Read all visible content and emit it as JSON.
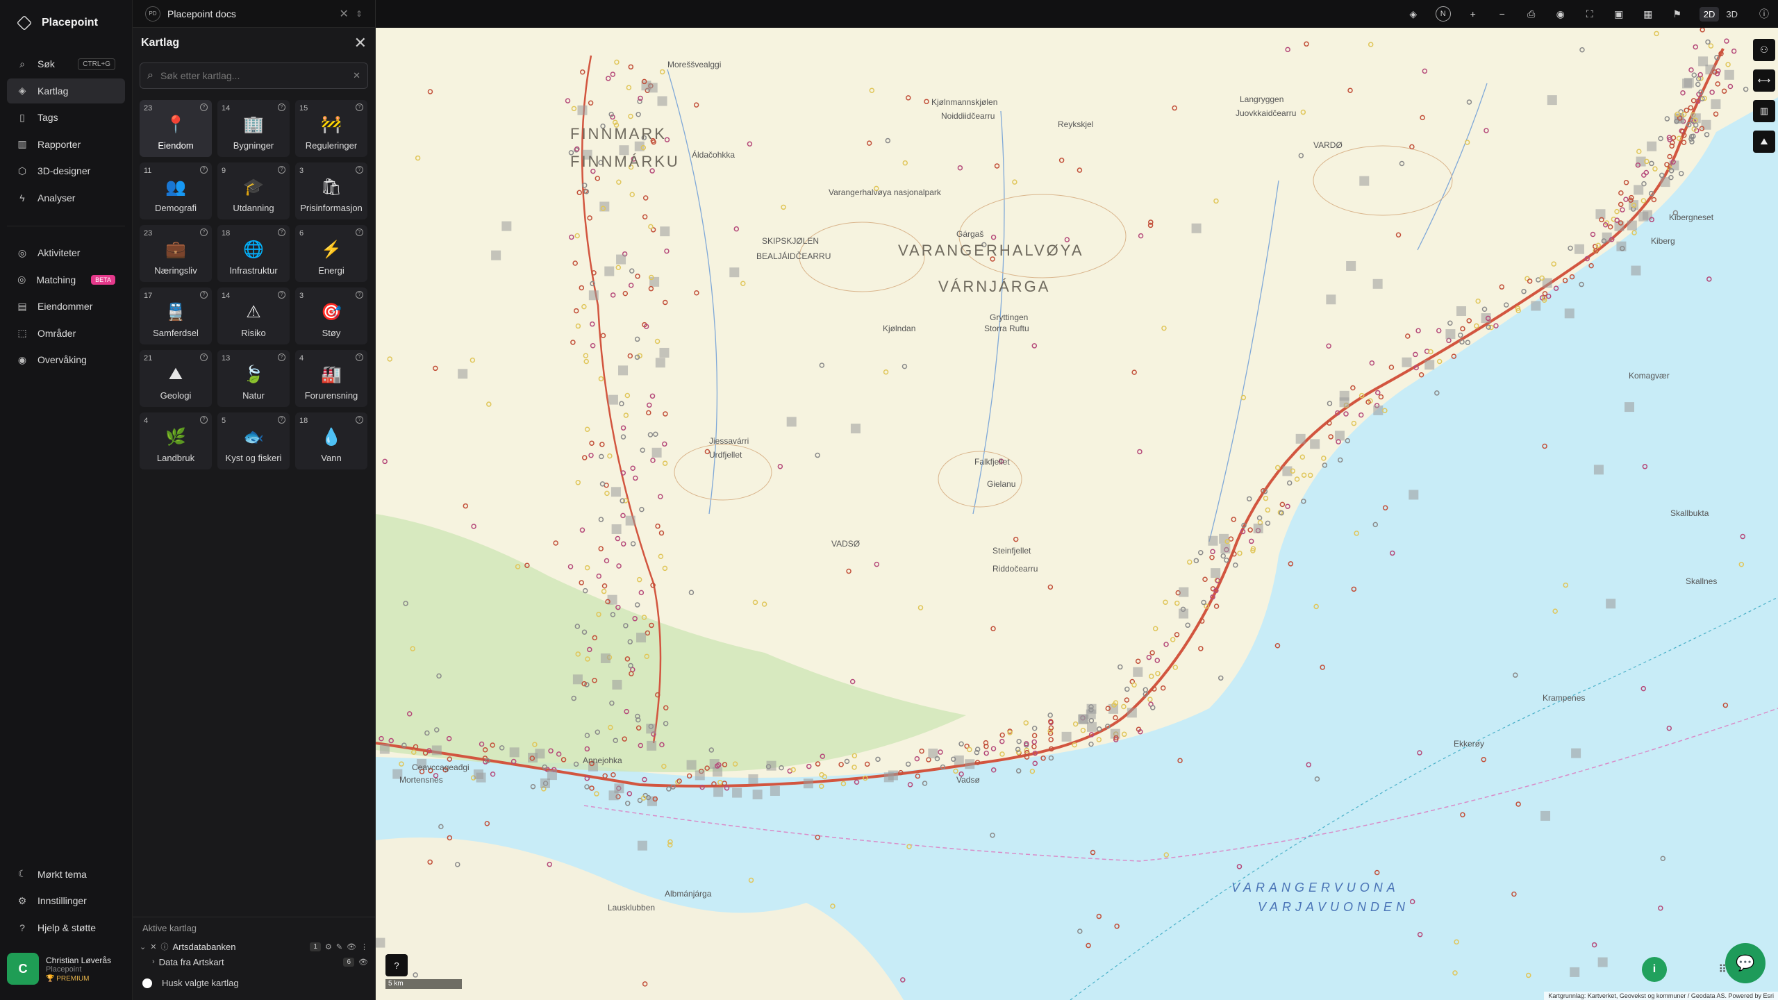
{
  "app": {
    "name": "Placepoint"
  },
  "nav": {
    "items": [
      {
        "label": "Søk",
        "icon": "search-icon",
        "shortcut": "CTRL+G"
      },
      {
        "label": "Kartlag",
        "icon": "layers-icon",
        "active": true
      },
      {
        "label": "Tags",
        "icon": "bookmark-icon"
      },
      {
        "label": "Rapporter",
        "icon": "chart-icon"
      },
      {
        "label": "3D-designer",
        "icon": "cube-icon"
      },
      {
        "label": "Analyser",
        "icon": "bolt-icon"
      }
    ],
    "items2": [
      {
        "label": "Aktiviteter",
        "icon": "activity-icon"
      },
      {
        "label": "Matching",
        "icon": "target-icon",
        "badge": "BETA"
      },
      {
        "label": "Eiendommer",
        "icon": "building-icon"
      },
      {
        "label": "Områder",
        "icon": "area-icon"
      },
      {
        "label": "Overvåking",
        "icon": "monitor-icon"
      }
    ],
    "bottom": [
      {
        "label": "Mørkt tema",
        "icon": "moon-icon"
      },
      {
        "label": "Innstillinger",
        "icon": "gear-icon"
      },
      {
        "label": "Hjelp & støtte",
        "icon": "help-icon"
      }
    ],
    "user": {
      "initial": "C",
      "name": "Christian Løverås",
      "org": "Placepoint",
      "plan": "PREMIUM"
    }
  },
  "tab": {
    "badge": "PD",
    "title": "Placepoint docs"
  },
  "panel": {
    "title": "Kartlag",
    "search_placeholder": "Søk etter kartlag...",
    "tiles": [
      {
        "count": "23",
        "label": "Eiendom",
        "icon": "📍",
        "active": true
      },
      {
        "count": "14",
        "label": "Bygninger",
        "icon": "🏢"
      },
      {
        "count": "15",
        "label": "Reguleringer",
        "icon": "🚧"
      },
      {
        "count": "11",
        "label": "Demografi",
        "icon": "👥"
      },
      {
        "count": "9",
        "label": "Utdanning",
        "icon": "🎓"
      },
      {
        "count": "3",
        "label": "Prisinformasjon",
        "icon": "🛍"
      },
      {
        "count": "23",
        "label": "Næringsliv",
        "icon": "💼"
      },
      {
        "count": "18",
        "label": "Infrastruktur",
        "icon": "🌐"
      },
      {
        "count": "6",
        "label": "Energi",
        "icon": "⚡"
      },
      {
        "count": "17",
        "label": "Samferdsel",
        "icon": "🚆"
      },
      {
        "count": "14",
        "label": "Risiko",
        "icon": "⚠"
      },
      {
        "count": "3",
        "label": "Støy",
        "icon": "🎯"
      },
      {
        "count": "21",
        "label": "Geologi",
        "icon": "⛰"
      },
      {
        "count": "13",
        "label": "Natur",
        "icon": "🍃"
      },
      {
        "count": "4",
        "label": "Forurensning",
        "icon": "🏭"
      },
      {
        "count": "4",
        "label": "Landbruk",
        "icon": "🌿"
      },
      {
        "count": "5",
        "label": "Kyst og fiskeri",
        "icon": "🐟"
      },
      {
        "count": "18",
        "label": "Vann",
        "icon": "💧"
      }
    ],
    "active_layers_title": "Aktive kartlag",
    "active_layers": [
      {
        "name": "Artsdatabanken",
        "count": "1"
      },
      {
        "name": "Data fra Artskart",
        "count": "6"
      }
    ],
    "remember": "Husk valgte kartlag"
  },
  "toolbar": {
    "north": "N",
    "mode_2d": "2D",
    "mode_3d": "3D"
  },
  "map": {
    "labels": [
      {
        "text": "FINNMARK",
        "cls": "big"
      },
      {
        "text": "FINNMÁRKU",
        "cls": "big"
      },
      {
        "text": "VARANGERHALVØYA",
        "cls": "big"
      },
      {
        "text": "VÁRNJÁRGA",
        "cls": "big"
      },
      {
        "text": "VARANGERVUONA",
        "cls": "sea"
      },
      {
        "text": "VARJAVUONDEN",
        "cls": "sea"
      },
      {
        "text": "Varangerhalvøya nasjonalpark"
      },
      {
        "text": "SKIPSKJØLEN"
      },
      {
        "text": "BEALJÁIDČEARRU"
      },
      {
        "text": "Kjølnmannskjølen"
      },
      {
        "text": "Noiddiidčearru"
      },
      {
        "text": "Langryggen"
      },
      {
        "text": "Juovkkaidčearru"
      },
      {
        "text": "VARDØ"
      },
      {
        "text": "Moreššvealggi"
      },
      {
        "text": "Áldačohkka"
      },
      {
        "text": "Gárgaš"
      },
      {
        "text": "Kjølndan"
      },
      {
        "text": "Jiessavárri"
      },
      {
        "text": "Urdfjellet"
      },
      {
        "text": "Falkfjellet"
      },
      {
        "text": "Gielanu"
      },
      {
        "text": "Steinfjellet"
      },
      {
        "text": "Riddočearru"
      },
      {
        "text": "VADSØ"
      },
      {
        "text": "Vadsø"
      },
      {
        "text": "Kiberg"
      },
      {
        "text": "Kibergneset"
      },
      {
        "text": "Komagvær"
      },
      {
        "text": "Skallnes"
      },
      {
        "text": "Skallbukta"
      },
      {
        "text": "Krampenes"
      },
      {
        "text": "Ekkerøy"
      },
      {
        "text": "Mortensnes"
      },
      {
        "text": "Ceavccageađgi"
      },
      {
        "text": "Annejohka"
      },
      {
        "text": "Lausklubben"
      },
      {
        "text": "Albmánjárga"
      },
      {
        "text": "Gryttingen"
      },
      {
        "text": "Storra Ruftu"
      },
      {
        "text": "Reykskjel"
      }
    ],
    "scale": "5 km",
    "attribution": "Kartgrunnlag: Kartverket, Geovekst og kommuner / Geodata AS. Powered by Esri"
  }
}
